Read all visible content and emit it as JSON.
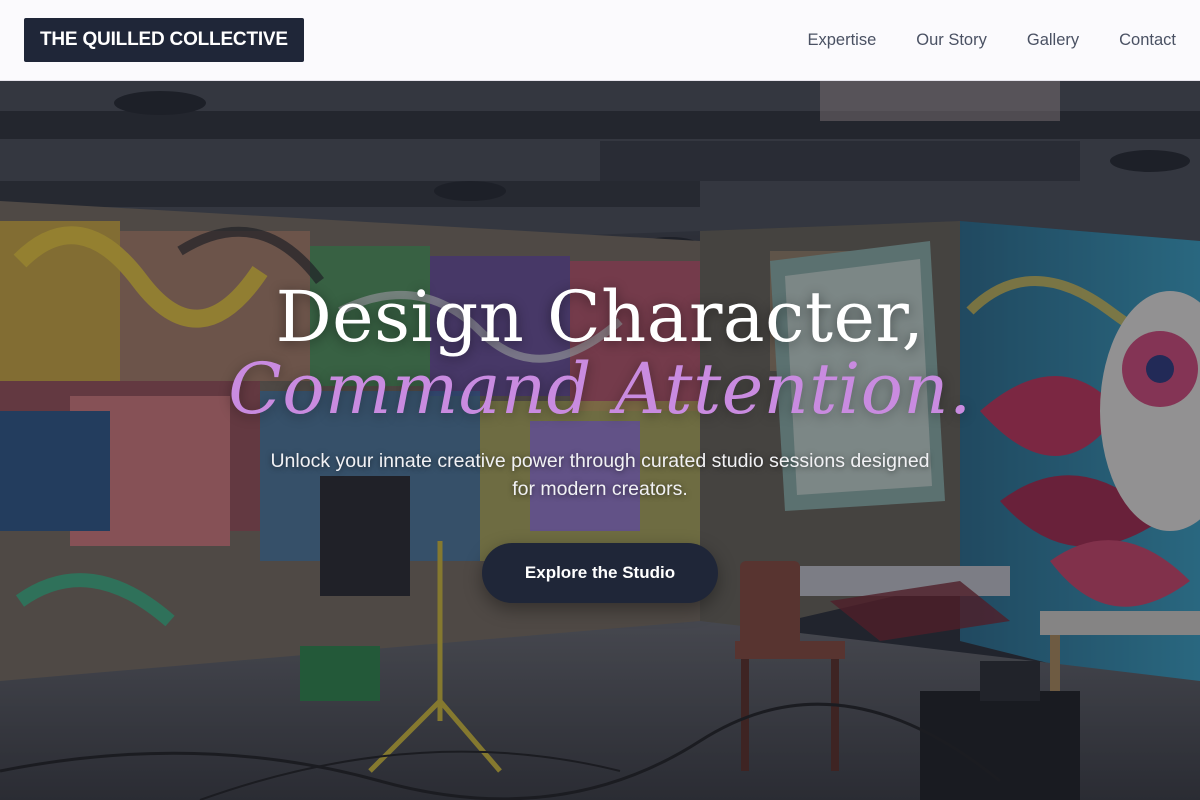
{
  "header": {
    "logo_text": "THE QUILLED COLLECTIVE",
    "nav": [
      {
        "label": "Expertise"
      },
      {
        "label": "Our Story"
      },
      {
        "label": "Gallery"
      },
      {
        "label": "Contact"
      }
    ]
  },
  "hero": {
    "headline_line1": "Design Character,",
    "headline_line2": "Command Attention.",
    "subtitle": "Unlock your innate creative power through curated studio sessions designed for modern creators.",
    "cta_label": "Explore the Studio"
  },
  "colors": {
    "brand_dark": "#1f2638",
    "accent_purple": "#c98be0",
    "header_bg": "#fbfafd",
    "nav_text": "#4a5163"
  }
}
